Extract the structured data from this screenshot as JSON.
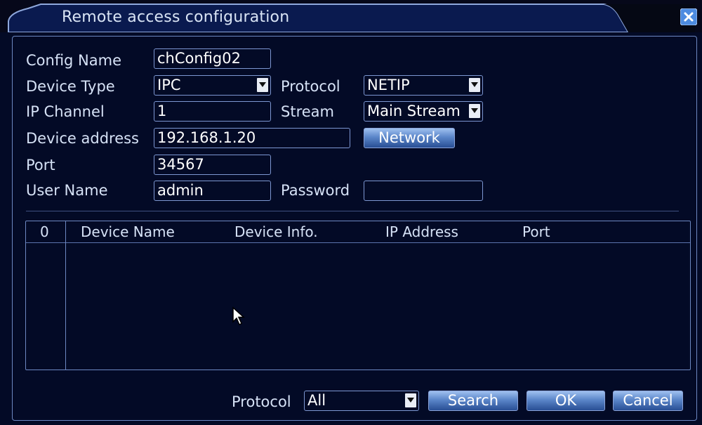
{
  "window": {
    "title": "Remote access configuration"
  },
  "form": {
    "config_name": {
      "label": "Config Name",
      "value": "chConfig02"
    },
    "device_type": {
      "label": "Device Type",
      "value": "IPC"
    },
    "protocol": {
      "label": "Protocol",
      "value": "NETIP"
    },
    "ip_channel": {
      "label": "IP Channel",
      "value": "1"
    },
    "stream": {
      "label": "Stream",
      "value": "Main Stream"
    },
    "device_address": {
      "label": "Device address",
      "value": "192.168.1.20"
    },
    "network_button": "Network",
    "port": {
      "label": "Port",
      "value": "34567"
    },
    "user_name": {
      "label": "User Name",
      "value": "admin"
    },
    "password": {
      "label": "Password",
      "value": ""
    }
  },
  "table": {
    "columns": [
      "0",
      "Device Name",
      "Device Info.",
      "IP Address",
      "Port"
    ],
    "rows": []
  },
  "footer": {
    "protocol_label": "Protocol",
    "protocol_filter": "All",
    "search_button": "Search",
    "ok_button": "OK",
    "cancel_button": "Cancel"
  },
  "colors": {
    "background": "#030a26",
    "border": "#6d88c2",
    "button": "#5b86c9",
    "close": "#4d8be0"
  },
  "icons": {
    "close": "close-icon",
    "dropdown": "chevron-down-icon",
    "cursor": "mouse-pointer-icon"
  }
}
